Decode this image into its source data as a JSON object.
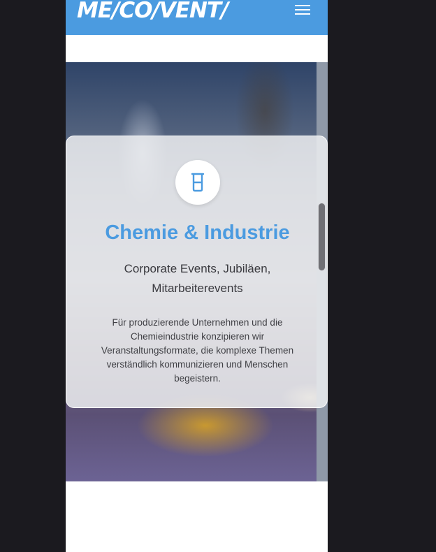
{
  "header": {
    "logo_text": "ME/CO/VENT/",
    "menu_icon": "hamburger-menu-icon",
    "background_color": "#4b9be0"
  },
  "card": {
    "icon": "beaker-icon",
    "title": "Chemie & Industrie",
    "subtitle": "Corporate Events, Jubiläen, Mitarbeiterevents",
    "text": "Für produzierende Unternehmen und die Chemieindustrie konzipieren wir Veranstaltungsformate, die komplexe Themen verständlich kommunizieren und Menschen begeistern.",
    "accent_color": "#4b9be0"
  }
}
